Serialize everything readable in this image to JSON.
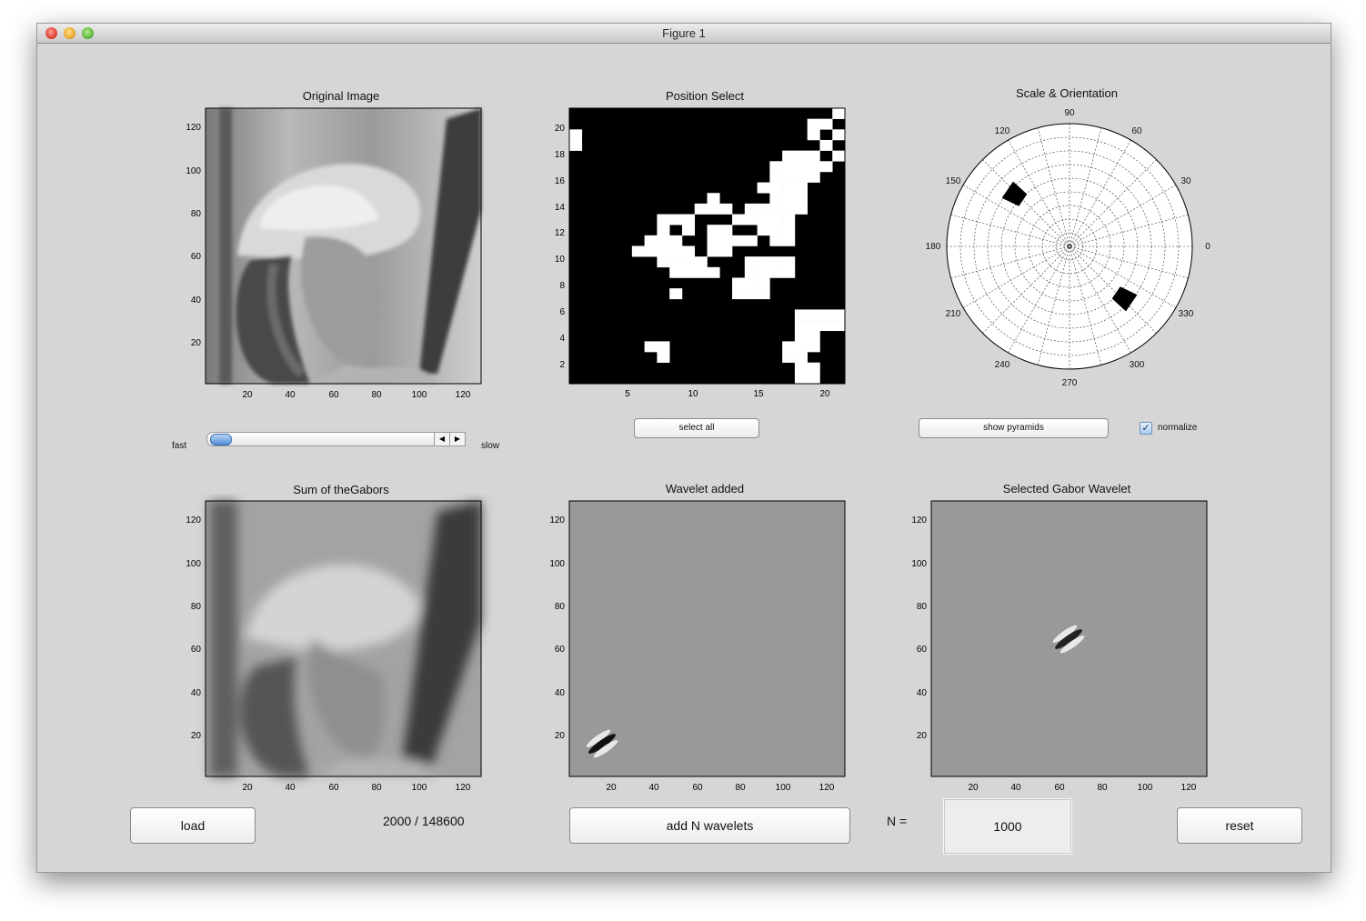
{
  "window": {
    "title": "Figure 1"
  },
  "panels": {
    "original": {
      "title": "Original Image",
      "xticks": [
        "20",
        "40",
        "60",
        "80",
        "100",
        "120"
      ],
      "yticks": [
        "20",
        "40",
        "60",
        "80",
        "100",
        "120"
      ]
    },
    "position": {
      "title": "Position Select",
      "xticks": [
        "5",
        "10",
        "15",
        "20"
      ],
      "yticks": [
        "2",
        "4",
        "6",
        "8",
        "10",
        "12",
        "14",
        "16",
        "18",
        "20"
      ]
    },
    "polar": {
      "title": "Scale & Orientation",
      "angles": [
        "90",
        "60",
        "30",
        "0",
        "330",
        "300",
        "270",
        "240",
        "210",
        "180",
        "150",
        "120"
      ]
    },
    "sum": {
      "title": "Sum of theGabors",
      "xticks": [
        "20",
        "40",
        "60",
        "80",
        "100",
        "120"
      ],
      "yticks": [
        "20",
        "40",
        "60",
        "80",
        "100",
        "120"
      ]
    },
    "added": {
      "title": "Wavelet added",
      "xticks": [
        "20",
        "40",
        "60",
        "80",
        "100",
        "120"
      ],
      "yticks": [
        "20",
        "40",
        "60",
        "80",
        "100",
        "120"
      ]
    },
    "selected": {
      "title": "Selected Gabor Wavelet",
      "xticks": [
        "20",
        "40",
        "60",
        "80",
        "100",
        "120"
      ],
      "yticks": [
        "20",
        "40",
        "60",
        "80",
        "100",
        "120"
      ]
    }
  },
  "controls": {
    "speed_fast": "fast",
    "speed_slow": "slow",
    "speed_value": 0.0,
    "select_all": "select all",
    "show_pyramids": "show pyramids",
    "normalize": "normalize",
    "normalize_checked": true,
    "load": "load",
    "counter": "2000 / 148600",
    "add": "add N wavelets",
    "n_label": "N =",
    "n_value": "1000",
    "reset": "reset"
  },
  "position_grid": [
    "0000000000000000000001",
    "0000000000000000000110",
    "1000000000000000000101",
    "1000000000000000000010",
    "0000000000000000011101",
    "0000000000000000111110",
    "0000000000000000111100",
    "0000000000000001111000",
    "0000000000010000111000",
    "0000000000111011111000",
    "0000000111000111110000",
    "0000000101011001110000",
    "0000001110011110110000",
    "0000011111011000000000",
    "0000000111100011110000",
    "0000000011110011110000",
    "0000000000000111000000",
    "0000000010000111000000",
    "0000000000000000000000",
    "0000000000000000001111",
    "0000000000000000001111",
    "0000000000000000001100",
    "0000001100000000011100",
    "0000000100000000011000",
    "0000000000000000001100",
    "0000000000000000001100"
  ],
  "icons": {
    "window_controls": [
      "close-icon",
      "minimize-icon",
      "zoom-icon"
    ],
    "slider_arrows": [
      "arrow-left-icon",
      "arrow-right-icon"
    ],
    "checkbox": "checkmark-icon"
  },
  "colors": {
    "figure_bg": "#d6d6d6",
    "selection_white": "#ffffff",
    "selection_black": "#000000",
    "wavelet_gray": "#999999"
  }
}
